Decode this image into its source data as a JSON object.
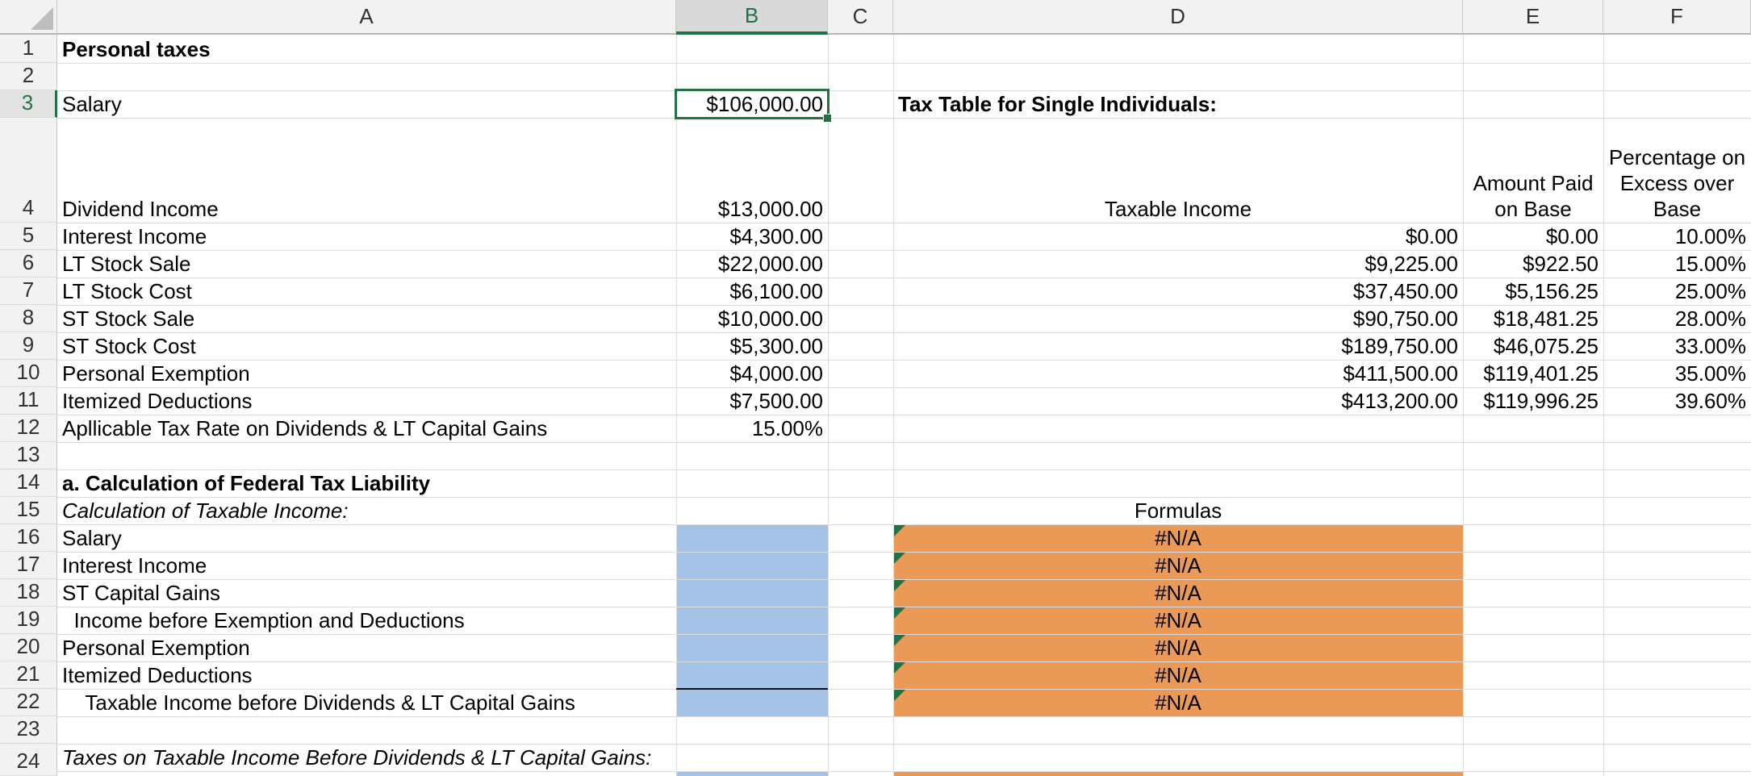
{
  "columns": [
    "A",
    "B",
    "C",
    "D",
    "E",
    "F"
  ],
  "selected_column": "B",
  "selected_row": "3",
  "rows": [
    "1",
    "2",
    "3",
    "4",
    "5",
    "6",
    "7",
    "8",
    "9",
    "10",
    "11",
    "12",
    "13",
    "14",
    "15",
    "16",
    "17",
    "18",
    "19",
    "20",
    "21",
    "22",
    "23",
    "24"
  ],
  "labels": {
    "r1": "Personal taxes",
    "r3": "Salary",
    "r4": "Dividend Income",
    "r5": "Interest Income",
    "r6": "LT Stock Sale",
    "r7": "LT Stock Cost",
    "r8": "ST Stock Sale",
    "r9": "ST Stock Cost",
    "r10": "Personal Exemption",
    "r11": "Itemized Deductions",
    "r12": "Apllicable Tax Rate on Dividends & LT Capital Gains",
    "r14": "a.  Calculation of Federal Tax Liability",
    "r15": "Calculation of Taxable Income:",
    "r16": "Salary",
    "r17": "Interest Income",
    "r18": "ST Capital Gains",
    "r19": "  Income before Exemption and Deductions",
    "r20": "Personal Exemption",
    "r21": "Itemized Deductions",
    "r22": "    Taxable Income before Dividends & LT Capital Gains",
    "r24": "Taxes on Taxable Income Before Dividends & LT Capital Gains:"
  },
  "values_b": {
    "r3": "$106,000.00",
    "r4": "$13,000.00",
    "r5": "$4,300.00",
    "r6": "$22,000.00",
    "r7": "$6,100.00",
    "r8": "$10,000.00",
    "r9": "$5,300.00",
    "r10": "$4,000.00",
    "r11": "$7,500.00",
    "r12": "15.00%"
  },
  "tax_table": {
    "title": "Tax Table for Single Individuals:",
    "header_d": "Taxable Income",
    "header_e": "Amount Paid on Base",
    "header_f": "Percentage on Excess over Base",
    "rows": [
      {
        "income": "$0.00",
        "base": "$0.00",
        "pct": "10.00%"
      },
      {
        "income": "$9,225.00",
        "base": "$922.50",
        "pct": "15.00%"
      },
      {
        "income": "$37,450.00",
        "base": "$5,156.25",
        "pct": "25.00%"
      },
      {
        "income": "$90,750.00",
        "base": "$18,481.25",
        "pct": "28.00%"
      },
      {
        "income": "$189,750.00",
        "base": "$46,075.25",
        "pct": "33.00%"
      },
      {
        "income": "$411,500.00",
        "base": "$119,401.25",
        "pct": "35.00%"
      },
      {
        "income": "$413,200.00",
        "base": "$119,996.25",
        "pct": "39.60%"
      }
    ]
  },
  "formulas": {
    "header": "Formulas",
    "values": [
      "#N/A",
      "#N/A",
      "#N/A",
      "#N/A",
      "#N/A",
      "#N/A",
      "#N/A"
    ]
  },
  "colors": {
    "input_fill": "#a4c2e5",
    "formula_fill": "#ea9a56",
    "selection": "#217346"
  }
}
